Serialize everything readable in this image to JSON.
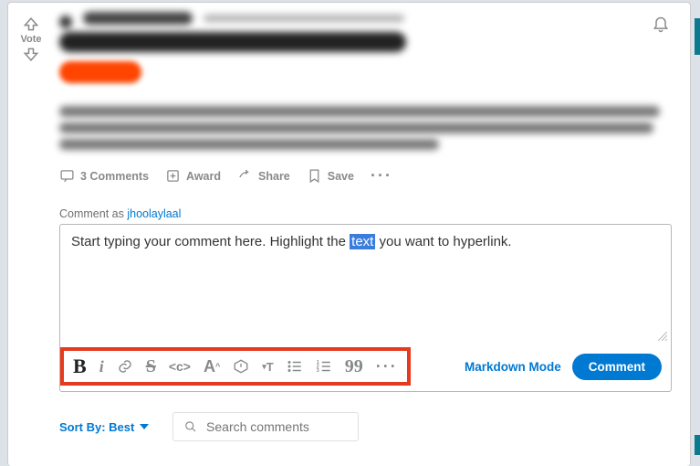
{
  "vote": {
    "label": "Vote"
  },
  "actions": {
    "comments": "3 Comments",
    "award": "Award",
    "share": "Share",
    "save": "Save"
  },
  "comment": {
    "as_label": "Comment as ",
    "username": "jhoolaylaal",
    "text_before": "Start typing your comment here. Highlight the ",
    "text_selected": "text",
    "text_after": " you want to hyperlink."
  },
  "toolbar": {
    "markdown": "Markdown Mode",
    "comment_btn": "Comment"
  },
  "sort": {
    "label": "Sort By: Best",
    "search_placeholder": "Search comments"
  }
}
